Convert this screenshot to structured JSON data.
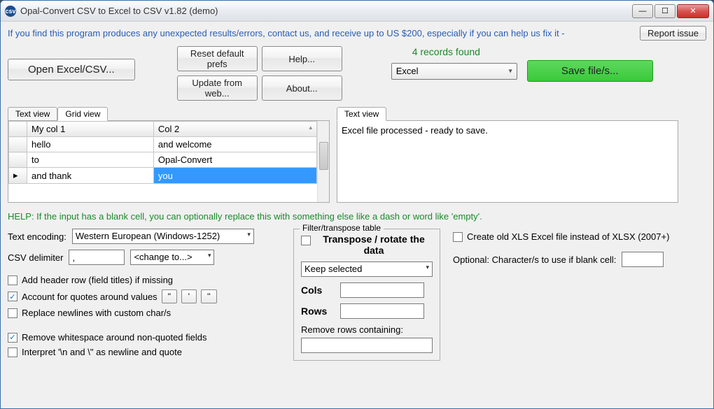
{
  "window": {
    "title": "Opal-Convert CSV to Excel to CSV v1.82 (demo)",
    "icon_label": "csv"
  },
  "banner": {
    "message": "If you find this program produces any unexpected results/errors, contact us, and receive up to US $200, especially if you can help us fix it -",
    "report_btn": "Report issue"
  },
  "toolbar": {
    "open_btn": "Open Excel/CSV...",
    "reset_btn": "Reset default prefs",
    "help_btn": "Help...",
    "update_btn": "Update from web...",
    "about_btn": "About...",
    "records_found": "4 records found",
    "output_format": "Excel",
    "save_btn": "Save file/s..."
  },
  "left_panel": {
    "tabs": {
      "text": "Text view",
      "grid": "Grid view"
    },
    "grid": {
      "headers": [
        "",
        "My col 1",
        "Col 2"
      ],
      "rows": [
        [
          "",
          "hello",
          "and welcome"
        ],
        [
          "",
          "to",
          "Opal-Convert"
        ],
        [
          "▸",
          "and thank",
          "you"
        ]
      ],
      "selected": {
        "row": 2,
        "col": 2
      }
    }
  },
  "right_panel": {
    "tab": "Text view",
    "text": "Excel file processed - ready to save."
  },
  "help_line": "HELP: If the input has a blank cell, you can optionally replace this with something else like a dash or word like 'empty'.",
  "options": {
    "encoding_label": "Text encoding:",
    "encoding_value": "Western European (Windows-1252)",
    "delimiter_label": "CSV delimiter",
    "delimiter_value": ",",
    "change_to": "<change to...>",
    "add_header": "Add header row (field titles) if missing",
    "account_quotes": "Account for quotes around values",
    "quote_btns": [
      "\"",
      "'",
      "''"
    ],
    "replace_newlines": "Replace newlines with custom char/s",
    "remove_whitespace": "Remove whitespace around non-quoted fields",
    "interpret_esc": "Interpret '\\n and \\\" as newline and quote"
  },
  "filter": {
    "legend": "Filter/transpose table",
    "transpose_label": "Transpose / rotate the data",
    "keep_selected": "Keep selected",
    "cols_label": "Cols",
    "rows_label": "Rows",
    "remove_rows_label": "Remove rows containing:"
  },
  "right_opts": {
    "create_old_xls": "Create old XLS Excel file instead of XLSX (2007+)",
    "blank_cell_label": "Optional: Character/s to use if blank cell:"
  }
}
